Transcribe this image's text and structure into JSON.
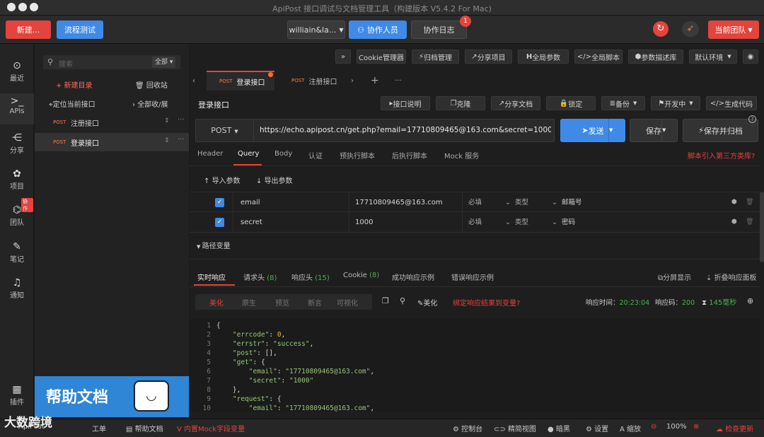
{
  "window": {
    "title": "ApiPost 接口调试与文档管理工具（构建版本 V5.4.2 For Mac)"
  },
  "toolbar": {
    "new_label": "新建...",
    "flow_label": "流程测试",
    "user_label": "williain&la...",
    "collab_label": "协作人员",
    "log_label": "协作日志",
    "log_badge": "1",
    "team_label": "当前团队"
  },
  "nav": {
    "items": [
      {
        "icon": "⊙",
        "label": "最近"
      },
      {
        "icon": ">_",
        "label": "APIs"
      },
      {
        "icon": "⋲",
        "label": "分享"
      },
      {
        "icon": "✿",
        "label": "项目"
      },
      {
        "icon": "⌬",
        "label": "团队",
        "badge": "协作"
      },
      {
        "icon": "✎",
        "label": "笔记"
      },
      {
        "icon": "♫",
        "label": "通知"
      },
      {
        "icon": "▦",
        "label": "插件"
      }
    ]
  },
  "tree": {
    "search_placeholder": "搜索",
    "filter_label": "全部",
    "new_dir": "+ 新建目录",
    "recycle": "回收站",
    "locate": "定位当前接口",
    "collapse": "全部收/展",
    "items": [
      {
        "method": "POST",
        "name": "注册接口"
      },
      {
        "method": "POST",
        "name": "登录接口"
      }
    ],
    "banner_text": "帮助文档"
  },
  "top_actions": {
    "expand": "»",
    "cookie": "Cookie管理器",
    "archive": "归档管理",
    "share_project": "分享项目",
    "global_params": "全局参数",
    "global_script": "全局脚本",
    "param_lib": "参数描述库",
    "env": "默认环境"
  },
  "tabs": [
    {
      "method": "POST",
      "name": "登录接口"
    },
    {
      "method": "POST",
      "name": "注册接口"
    }
  ],
  "request": {
    "title": "登录接口",
    "doc_btn": "接口说明",
    "clone_btn": "克隆",
    "share_doc_btn": "分享文档",
    "lock_btn": "锁定",
    "backup_btn": "备份",
    "dev_btn": "开发中",
    "gen_code_btn": "生成代码",
    "method": "POST",
    "url": "https://echo.apipost.cn/get.php?email=17710809465@163.com&secret=1000",
    "send": "发送",
    "save": "保存",
    "save_archive": "保存并归档"
  },
  "subtabs": [
    "Header",
    "Query",
    "Body",
    "认证",
    "预执行脚本",
    "后执行脚本",
    "Mock 服务"
  ],
  "third_party_link": "脚本引入第三方类库?",
  "query": {
    "import": "导入参数",
    "export": "导出参数",
    "rows": [
      {
        "key": "email",
        "value": "17710809465@163.com",
        "required": "必填",
        "type": "类型",
        "desc": "邮箱号"
      },
      {
        "key": "secret",
        "value": "1000",
        "required": "必填",
        "type": "类型",
        "desc": "密码"
      }
    ],
    "path_vars": "路径变量"
  },
  "response": {
    "tabs": [
      {
        "label": "实时响应",
        "count": ""
      },
      {
        "label": "请求头",
        "count": "(8)"
      },
      {
        "label": "响应头",
        "count": "(15)"
      },
      {
        "label": "Cookie",
        "count": "(8)"
      },
      {
        "label": "成功响应示例",
        "count": ""
      },
      {
        "label": "错误响应示例",
        "count": ""
      }
    ],
    "split_view": "分屏显示",
    "fold_panel": "折叠响应面板",
    "views": [
      "美化",
      "原生",
      "预览",
      "断言",
      "可视化"
    ],
    "beautify": "美化",
    "bind": "绑定响应结果到变量?",
    "time_label": "响应时间：",
    "time": "20:23:04",
    "code_label": "响应码：",
    "code": "200",
    "duration": "145毫秒",
    "lines": [
      {
        "n": "1",
        "text": "{"
      },
      {
        "n": "2",
        "text": "    \"errcode\": 0,"
      },
      {
        "n": "3",
        "text": "    \"errstr\": \"success\","
      },
      {
        "n": "4",
        "text": "    \"post\": [],"
      },
      {
        "n": "5",
        "text": "    \"get\": {"
      },
      {
        "n": "6",
        "text": "        \"email\": \"17710809465@163.com\","
      },
      {
        "n": "7",
        "text": "        \"secret\": \"1000\""
      },
      {
        "n": "8",
        "text": "    },"
      },
      {
        "n": "9",
        "text": "    \"request\": {"
      },
      {
        "n": "10",
        "text": "        \"email\": \"17710809465@163.com\","
      }
    ]
  },
  "status": {
    "left1": "ApiPost",
    "left2": "工单",
    "help": "帮助文档",
    "mock": "内置Mock字段变量",
    "console": "控制台",
    "simple": "精简视图",
    "dark": "暗黑",
    "settings": "设置",
    "zoom_label": "缩放",
    "zoom": "100%",
    "update": "检查更新",
    "watermark": "大数跨境"
  },
  "colors": {
    "accent": "#3f8ae6",
    "danger": "#e5433d",
    "post": "#ff7a45"
  }
}
